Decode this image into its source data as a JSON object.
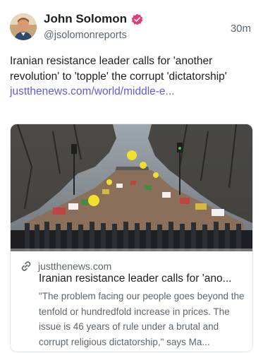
{
  "author": {
    "name": "John Solomon",
    "handle": "@jsolomonreports",
    "verified_icon": "verified-badge-icon",
    "avatar_icon": "avatar"
  },
  "post": {
    "time": "30m",
    "text": "Iranian resistance leader calls for 'another revolution' to 'topple' the corrupt 'dictatorship'",
    "link_text": "justthenews.com/world/middle-e..."
  },
  "card": {
    "domain": "justthenews.com",
    "title": "Iranian resistance leader calls for 'ano...",
    "description": "\"The problem facing our people goes beyond the tenfold or hundredfold increase in prices. The issue is 46 years of rule under a brutal and corrupt religious dictatorship,\" says Ma..."
  },
  "colors": {
    "link": "#5b5fd6",
    "verified": "#e23a7a",
    "muted": "#5b6670"
  }
}
